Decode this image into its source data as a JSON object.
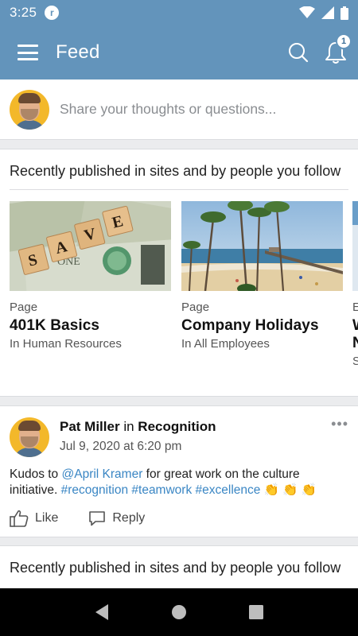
{
  "status_bar": {
    "time": "3:25",
    "app_icon_letter": "r"
  },
  "app_bar": {
    "title": "Feed",
    "notification_count": "1"
  },
  "composer": {
    "placeholder": "Share your thoughts or questions..."
  },
  "recent_section_1": {
    "heading": "Recently published in sites and by people you follow",
    "tiles": [
      {
        "type": "Page",
        "title": "401K Basics",
        "subtitle": "In Human Resources",
        "image": "save-money-image"
      },
      {
        "type": "Page",
        "title": "Company Holidays",
        "subtitle": "In All Employees",
        "image": "beach-pier-image"
      },
      {
        "type": "E",
        "title": "W",
        "subtitle": "S",
        "title2": "N"
      }
    ]
  },
  "post": {
    "author": "Pat Miller",
    "in_word": "in",
    "site": "Recognition",
    "date": "Jul 9, 2020 at 6:20 pm",
    "body_prefix": "Kudos to ",
    "mention": "@April Kramer",
    "body_middle": " for great work on the culture initiative. ",
    "tags": [
      "#recognition",
      "#teamwork",
      "#excellence"
    ],
    "emoji": "👏 👏 👏",
    "like_label": "Like",
    "reply_label": "Reply"
  },
  "recent_section_2": {
    "heading": "Recently published in sites and by people you follow"
  },
  "colors": {
    "brand": "#6394bb",
    "link": "#3a86c4",
    "clap": "#f3b82a"
  }
}
